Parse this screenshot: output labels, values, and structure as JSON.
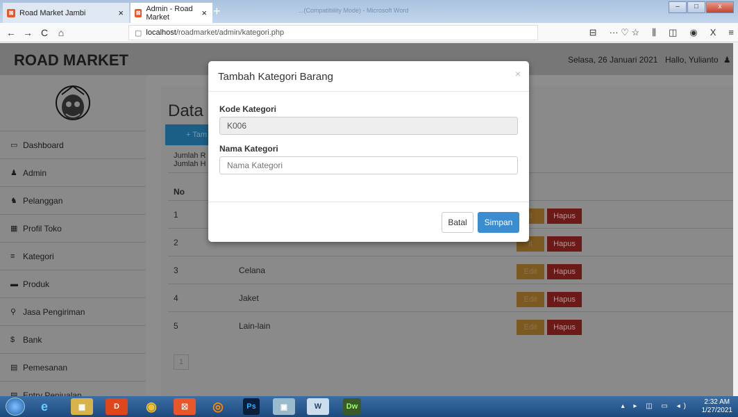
{
  "browser": {
    "tabs": [
      {
        "title": "Road Market Jambi",
        "close": "×"
      },
      {
        "title": "Admin - Road Market",
        "close": "×"
      }
    ],
    "new_tab": "+",
    "window_title": "...(Compatibility Mode) - Microsoft Word",
    "url_host": "localhost",
    "url_path": "/roadmarket/admin/kategori.php",
    "nav": {
      "back": "←",
      "forward": "→",
      "reload": "C",
      "home": "⌂"
    },
    "right_icons": [
      "⊟",
      "··· ♡ ☆",
      "⫼",
      "◫",
      "◉",
      "X",
      "≡"
    ],
    "window_controls": {
      "minimize": "–",
      "maximize": "□",
      "close": "x"
    }
  },
  "app": {
    "brand": "ROAD MARKET",
    "date": "Selasa, 26 Januari 2021",
    "greeting": "Hallo, Yulianto",
    "sidebar": [
      {
        "icon": "desktop-icon",
        "glyph": "▭",
        "label": "Dashboard"
      },
      {
        "icon": "user-icon",
        "glyph": "♟",
        "label": "Admin"
      },
      {
        "icon": "users-icon",
        "glyph": "♞",
        "label": "Pelanggan"
      },
      {
        "icon": "table-icon",
        "glyph": "▦",
        "label": "Profil Toko"
      },
      {
        "icon": "list-icon",
        "glyph": "≡",
        "label": "Kategori"
      },
      {
        "icon": "truck-icon",
        "glyph": "▬",
        "label": "Produk"
      },
      {
        "icon": "map-marker-icon",
        "glyph": "⚲",
        "label": "Jasa Pengiriman"
      },
      {
        "icon": "dollar-icon",
        "glyph": "$",
        "label": "Bank"
      },
      {
        "icon": "credit-card-icon",
        "glyph": "▤",
        "label": "Pemesanan"
      },
      {
        "icon": "credit-card-icon",
        "glyph": "▤",
        "label": "Entry Penjualan"
      }
    ],
    "page_title": "Data",
    "add_button": "+ Tam",
    "info": [
      "Jumlah R",
      "Jumlah H"
    ],
    "columns": [
      "No",
      "i"
    ],
    "rows": [
      {
        "no": "1",
        "name": ""
      },
      {
        "no": "2",
        "name": ""
      },
      {
        "no": "3",
        "name": "Celana"
      },
      {
        "no": "4",
        "name": "Jaket"
      },
      {
        "no": "5",
        "name": "Lain-lain"
      }
    ],
    "edit_label": "Edit",
    "edit_partial": "it",
    "hapus_label": "Hapus",
    "pagination": [
      "1"
    ]
  },
  "modal": {
    "title": "Tambah Kategori Barang",
    "close": "×",
    "kode_label": "Kode Kategori",
    "kode_value": "K006",
    "nama_label": "Nama Kategori",
    "nama_placeholder": "Nama Kategori",
    "cancel": "Batal",
    "save": "Simpan"
  },
  "taskbar": {
    "apps": [
      "e",
      "▦",
      "D",
      "◉",
      "☒",
      "◎",
      "Ps",
      "▣",
      "W",
      "Dw"
    ],
    "tray": "▴ ▸ ◫ ▭ ◂)",
    "time": "2:32 AM",
    "date": "1/27/2021"
  }
}
